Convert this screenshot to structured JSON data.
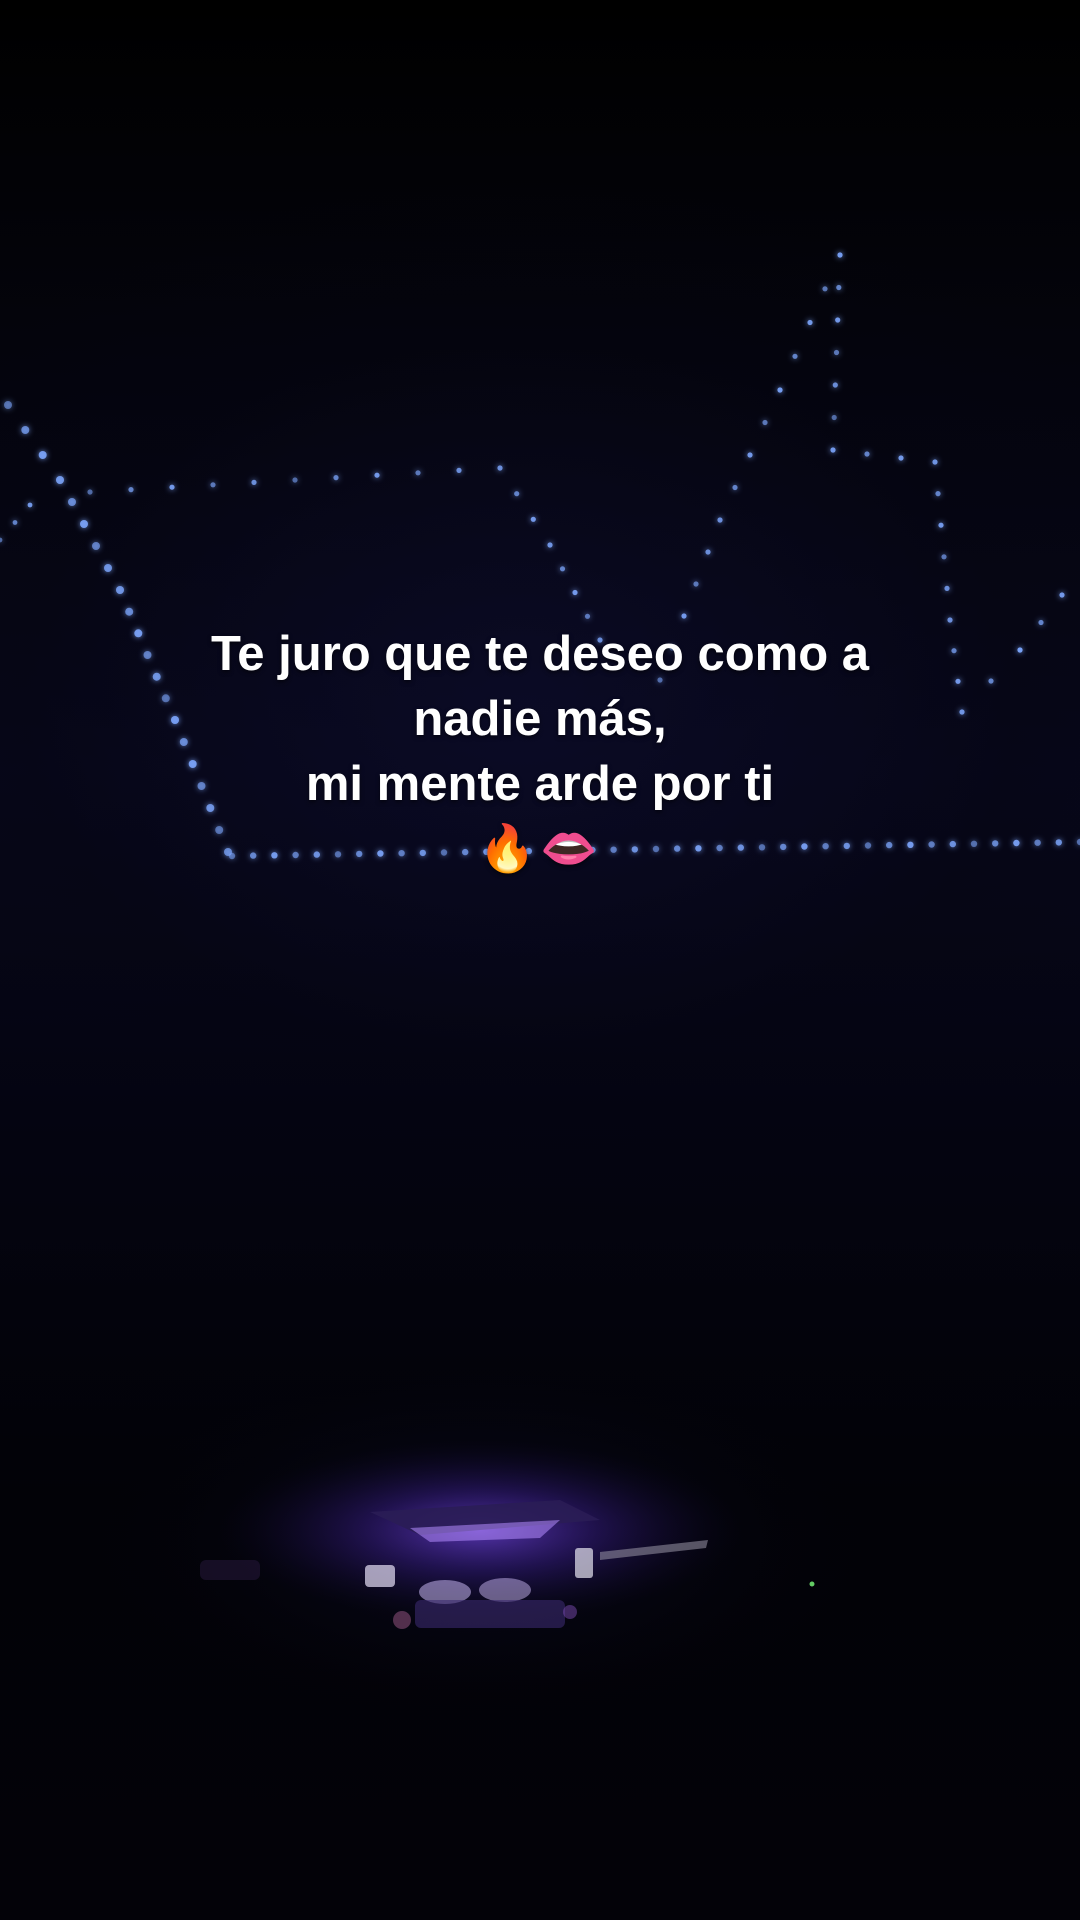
{
  "caption": {
    "line1": "Te juro que te deseo como a",
    "line2": "nadie más,",
    "line3": "mi mente arde por ti",
    "emoji": "🔥👄"
  },
  "scene": {
    "led_color": "#7ea8ff",
    "led_glow": "#3b5bff",
    "ambient_purple": "#7a3cff",
    "background": "#030207"
  }
}
